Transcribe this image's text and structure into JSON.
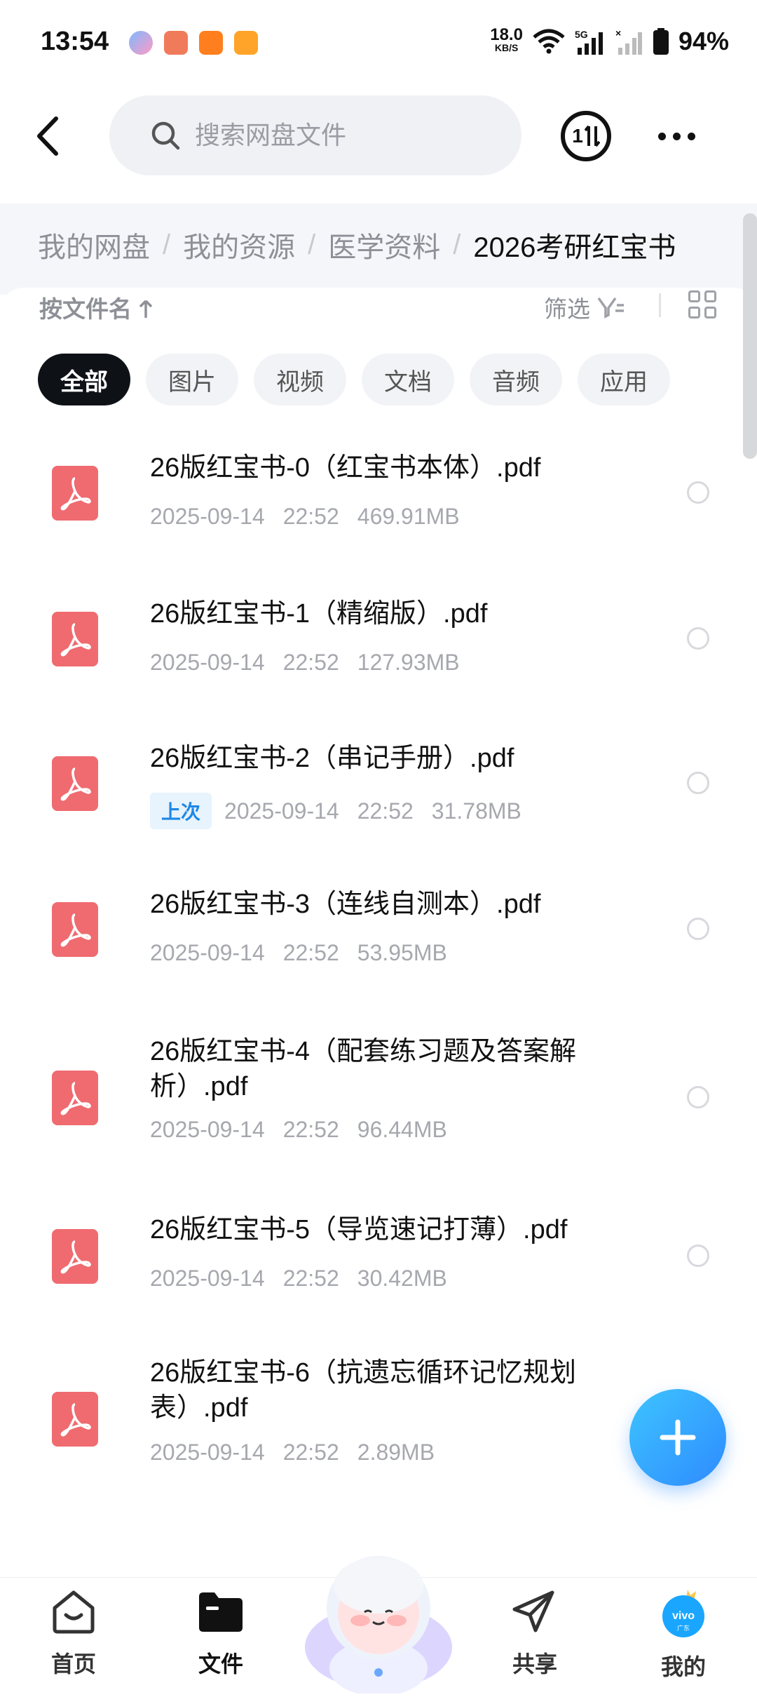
{
  "status_bar": {
    "time": "13:54",
    "net_speed": "18.0",
    "net_unit": "KB/S",
    "battery": "94%"
  },
  "header": {
    "search_placeholder": "搜索网盘文件",
    "transfer_badge": "1"
  },
  "breadcrumb": [
    "我的网盘",
    "我的资源",
    "医学资料",
    "2026考研红宝书"
  ],
  "toolbar": {
    "sort_label": "按文件名",
    "filter_label": "筛选"
  },
  "chips": [
    "全部",
    "图片",
    "视频",
    "文档",
    "音频",
    "应用"
  ],
  "files": [
    {
      "name": "26版红宝书-0（红宝书本体）.pdf",
      "date": "2025-09-14",
      "time": "22:52",
      "size": "469.91MB",
      "badge": ""
    },
    {
      "name": "26版红宝书-1（精缩版）.pdf",
      "date": "2025-09-14",
      "time": "22:52",
      "size": "127.93MB",
      "badge": ""
    },
    {
      "name": "26版红宝书-2（串记手册）.pdf",
      "date": "2025-09-14",
      "time": "22:52",
      "size": "31.78MB",
      "badge": "上次"
    },
    {
      "name": "26版红宝书-3（连线自测本）.pdf",
      "date": "2025-09-14",
      "time": "22:52",
      "size": "53.95MB",
      "badge": ""
    },
    {
      "name": "26版红宝书-4（配套练习题及答案解析）.pdf",
      "date": "2025-09-14",
      "time": "22:52",
      "size": "96.44MB",
      "badge": ""
    },
    {
      "name": "26版红宝书-5（导览速记打薄）.pdf",
      "date": "2025-09-14",
      "time": "22:52",
      "size": "30.42MB",
      "badge": ""
    },
    {
      "name": "26版红宝书-6（抗遗忘循环记忆规划表）.pdf",
      "date": "2025-09-14",
      "time": "22:52",
      "size": "2.89MB",
      "badge": ""
    }
  ],
  "bottom_nav": [
    {
      "label": "首页",
      "icon": "home-icon"
    },
    {
      "label": "文件",
      "icon": "folder-icon",
      "active": true
    },
    {
      "label": "共享",
      "icon": "share-icon"
    },
    {
      "label": "我的",
      "icon": "avatar-icon",
      "avatar_text": "vivo",
      "avatar_sub": "广东"
    }
  ],
  "colors": {
    "accent": "#2e8bff",
    "pdf": "#ef6b70",
    "chip_active": "#0e1217"
  }
}
